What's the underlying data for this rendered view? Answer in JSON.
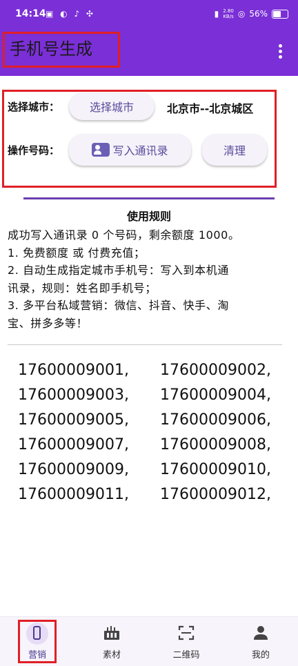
{
  "statusbar": {
    "time": "14:14",
    "icons": "▣ ◐ ♪ ✣",
    "signal": "▮",
    "speed_top": "2.80",
    "speed_bottom": "KB/s",
    "wifi": "◎",
    "battery": "56%"
  },
  "appbar": {
    "title": "手机号生成"
  },
  "form": {
    "city_label": "选择城市：",
    "city_button": "选择城市",
    "city_value": "北京市--北京城区",
    "op_label": "操作号码：",
    "write_button": "写入通讯录",
    "clear_button": "清理"
  },
  "rules": {
    "title": "使用规则",
    "lines": [
      "成功写入通讯录 0 个号码，剩余额度 1000。",
      "1. 免费额度 或 付费充值；",
      "2. 自动生成指定城市手机号：写入到本机通",
      "讯录，规则：姓名即手机号；",
      "3. 多平台私域营销：微信、抖音、快手、淘",
      "宝、拼多多等！"
    ]
  },
  "numbers": [
    [
      "17600009001,",
      "17600009002,"
    ],
    [
      "17600009003,",
      "17600009004,"
    ],
    [
      "17600009005,",
      "17600009006,"
    ],
    [
      "17600009007,",
      "17600009008,"
    ],
    [
      "17600009009,",
      "17600009010,"
    ],
    [
      "17600009011,",
      "17600009012,"
    ]
  ],
  "nav": {
    "items": [
      {
        "label": "营销",
        "icon": "phone-icon"
      },
      {
        "label": "素材",
        "icon": "materials-icon"
      },
      {
        "label": "二维码",
        "icon": "qr-scan-icon"
      },
      {
        "label": "我的",
        "icon": "person-icon"
      }
    ]
  },
  "colors": {
    "primary": "#7b2fd6",
    "highlight": "#e01f26",
    "accent": "#4a3b8f"
  }
}
